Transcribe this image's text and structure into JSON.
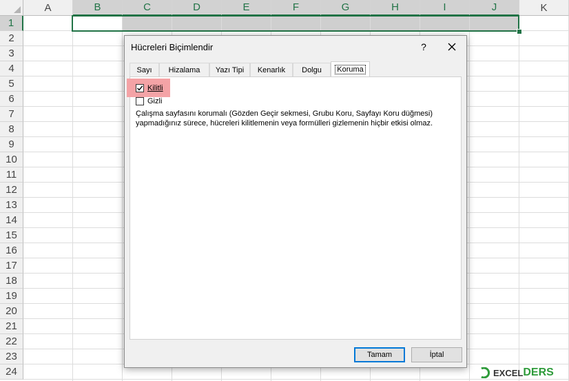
{
  "sheet": {
    "columns": [
      "A",
      "B",
      "C",
      "D",
      "E",
      "F",
      "G",
      "H",
      "I",
      "J",
      "K"
    ],
    "rows": [
      "1",
      "2",
      "3",
      "4",
      "5",
      "6",
      "7",
      "8",
      "9",
      "10",
      "11",
      "12",
      "13",
      "14",
      "15",
      "16",
      "17",
      "18",
      "19",
      "20",
      "21",
      "22",
      "23",
      "24"
    ],
    "selected_row": "1",
    "selected_columns": [
      "B",
      "C",
      "D",
      "E",
      "F",
      "G",
      "H",
      "I",
      "J"
    ]
  },
  "dialog": {
    "title": "Hücreleri Biçimlendir",
    "help_label": "?",
    "close_icon": "close-icon",
    "tabs": [
      "Sayı",
      "Hizalama",
      "Yazı Tipi",
      "Kenarlık",
      "Dolgu",
      "Koruma"
    ],
    "active_tab": "Koruma",
    "locked": {
      "label": "Kilitli",
      "checked": true,
      "highlight_color": "#f4a3a6"
    },
    "hidden": {
      "label": "Gizli",
      "checked": false
    },
    "description_line1": "Çalışma sayfasını korumalı (Gözden Geçir sekmesi, Grubu Koru, Sayfayı Koru düğmesi)",
    "description_line2": "yapmadığınız sürece, hücreleri kilitlemenin veya formülleri gizlemenin hiçbir etkisi olmaz.",
    "ok_label": "Tamam",
    "cancel_label": "İptal"
  },
  "watermark": {
    "part1": "EXCEL",
    "part2": "DERS",
    "accent": "#2e9b3a"
  },
  "colors": {
    "excel_green": "#217346",
    "focus_blue": "#0078d7"
  }
}
